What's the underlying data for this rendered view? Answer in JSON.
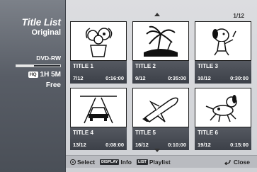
{
  "sidebar": {
    "title": "Title List",
    "subtitle": "Original",
    "disc_type": "DVD-RW",
    "quality": "HQ",
    "remaining_time": "1H 5M",
    "free_label": "Free",
    "usage_fraction": 0.4
  },
  "main": {
    "page_indicator": "1/12",
    "titles": [
      {
        "name": "TITLE 1",
        "date": "7/12",
        "duration": "0:16:00",
        "thumb": "flower-vase-icon"
      },
      {
        "name": "TITLE 2",
        "date": "9/12",
        "duration": "0:35:00",
        "thumb": "palm-tree-island-icon"
      },
      {
        "name": "TITLE 3",
        "date": "10/12",
        "duration": "0:30:00",
        "thumb": "cartoon-dog-icon"
      },
      {
        "name": "TITLE 4",
        "date": "13/12",
        "duration": "0:08:00",
        "thumb": "car-road-icon"
      },
      {
        "name": "TITLE 5",
        "date": "16/12",
        "duration": "0:10:00",
        "thumb": "space-shuttle-icon"
      },
      {
        "name": "TITLE 6",
        "date": "19/12",
        "duration": "0:15:00",
        "thumb": "running-dog-icon"
      }
    ]
  },
  "footer": {
    "select_label": "Select",
    "display_key": "DISPLAY",
    "info_label": "Info",
    "list_key": "LIST",
    "playlist_label": "Playlist",
    "close_label": "Close"
  }
}
